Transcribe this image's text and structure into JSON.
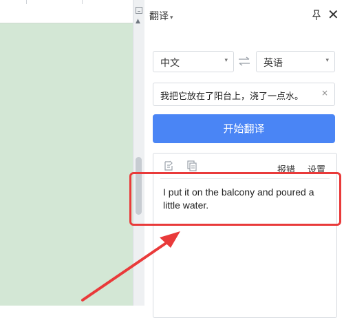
{
  "panel": {
    "title": "翻译",
    "title_caret": "▾",
    "close_glyph": "✕"
  },
  "languages": {
    "source": "中文",
    "target": "英语",
    "dropdown_glyph": "▾"
  },
  "input": {
    "value": "我把它放在了阳台上，浇了一点水。",
    "clear_glyph": "×"
  },
  "translate_button": {
    "label": "开始翻译"
  },
  "result": {
    "report_label": "报错",
    "settings_label": "设置",
    "text": "I put it on the balcony and poured a little water."
  },
  "scrollbar": {
    "up_glyph": "▲"
  },
  "colors": {
    "accent": "#4a85f5",
    "highlight": "#e93a3a",
    "document_bg": "#d3e7d5"
  },
  "icons": [
    "pin-icon",
    "close-icon",
    "swap-icon",
    "clear-icon",
    "copy-source-icon",
    "copy-result-icon"
  ]
}
